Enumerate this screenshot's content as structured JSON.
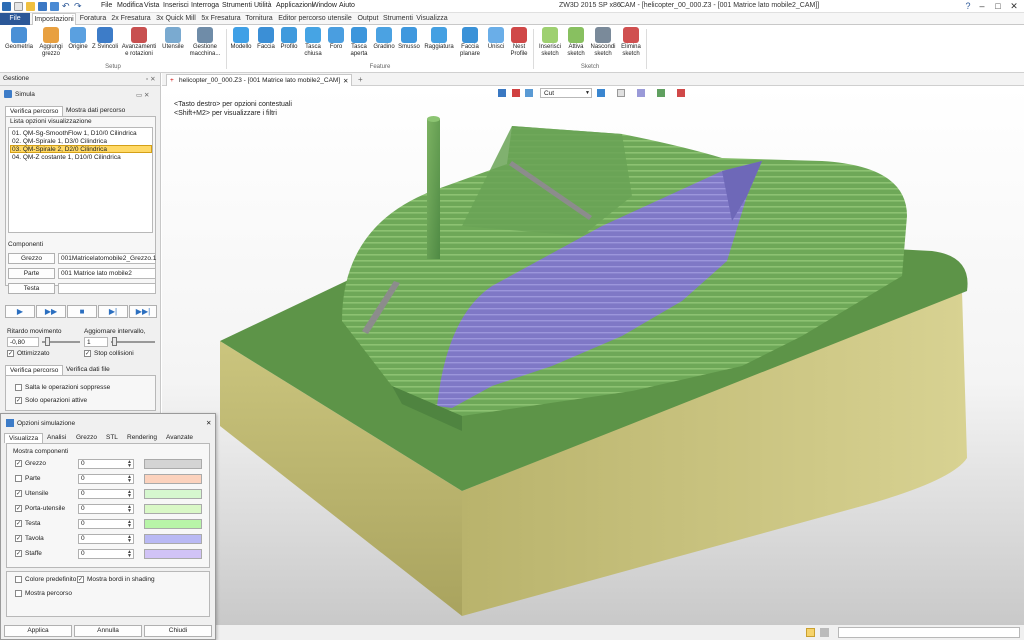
{
  "app": {
    "title": "ZW3D 2015 SP x86",
    "window_title": "CAM - [helicopter_00_000.Z3 - [001 Matrice lato mobile2_CAM]]",
    "menu": [
      "File",
      "Modifica",
      "Vista",
      "Inserisci",
      "Interroga",
      "Strumenti",
      "Utilità",
      "Applicazioni",
      "Window",
      "Aiuto"
    ]
  },
  "ribbon_tabs": [
    "File",
    "Impostazioni",
    "Foratura",
    "2x Fresatura",
    "3x Quick Mill",
    "5x Fresatura",
    "Tornitura",
    "Editor percorso utensile",
    "Output",
    "Strumenti",
    "Visualizza"
  ],
  "ribbon": {
    "setup": [
      "Geometria",
      "Aggiungi\ngrezzo",
      "Origine",
      "Z Svincoli",
      "Avanzamenti\ne rotazioni",
      "Utensile",
      "Gestione\nmacchina..."
    ],
    "feature": [
      "Modello",
      "Faccia",
      "Profilo",
      "Tasca\nchiusa",
      "Foro",
      "Tasca\naperta",
      "Gradino",
      "Smusso",
      "Raggiatura",
      "Faccia\nplanare",
      "Unisci",
      "Nest\nProfile"
    ],
    "sketch": [
      "Inserisci\nsketch",
      "Attiva\nsketch",
      "Nascondi\nsketch",
      "Elimina\nsketch"
    ],
    "groups": [
      "Setup",
      "Feature",
      "Sketch"
    ]
  },
  "panel": {
    "title": "Gestione",
    "simula": "Simula",
    "tabs": [
      "Verifica percorso",
      "Mostra dati percorso"
    ],
    "list_label": "Lista opzioni visualizzazione",
    "operations": [
      "01. QM-Sg-SmoothFlow 1, D10/0 Cilindrica",
      "02. QM-Spirale 1, D3/0 Cilindrica",
      "03. QM-Spirale 2, D2/0 Cilindrica",
      "04. QM-Z costante 1, D10/0 Cilindrica"
    ],
    "componenti_label": "Componenti",
    "grezzo_btn": "Grezzo",
    "grezzo_val": "001Matricelatomobile2_Grezzo.1",
    "parte_btn": "Parte",
    "parte_val": "001 Matrice lato mobile2",
    "testa_btn": "Testa",
    "ritardo_label": "Ritardo movimento",
    "ritardo_val": "-0,80",
    "aggiornare_label": "Aggiornare intervallo,",
    "aggiornare_val": "1",
    "ottimizzato": "Ottimizzato",
    "stop_collisioni": "Stop collisioni",
    "tabs2": [
      "Verifica percorso",
      "Verifica dati file"
    ],
    "salta": "Salta le operazioni soppresse",
    "solo": "Solo operazioni attive"
  },
  "dialog": {
    "title": "Opzioni simulazione",
    "tabs": [
      "Visualizza",
      "Analisi",
      "Grezzo",
      "STL",
      "Rendering",
      "Avanzate"
    ],
    "group_label": "Mostra componenti",
    "rows": [
      {
        "label": "Grezzo",
        "checked": "✓",
        "value": "0",
        "color": "#d4d4d4"
      },
      {
        "label": "Parte",
        "checked": "",
        "value": "0",
        "color": "#fcd2bd"
      },
      {
        "label": "Utensile",
        "checked": "✓",
        "value": "0",
        "color": "#d6f7cf"
      },
      {
        "label": "Porta-utensile",
        "checked": "✓",
        "value": "0",
        "color": "#d9f8c6"
      },
      {
        "label": "Testa",
        "checked": "✓",
        "value": "0",
        "color": "#b8f4a8"
      },
      {
        "label": "Tavola",
        "checked": "✓",
        "value": "0",
        "color": "#b9b9f4"
      },
      {
        "label": "Staffe",
        "checked": "✓",
        "value": "0",
        "color": "#d1c3f6"
      }
    ],
    "colore_predefinito": "Colore predefinito",
    "mostra_bordi": "Mostra bordi in shading",
    "mostra_percorso": "Mostra percorso",
    "applica": "Applica",
    "annulla": "Annulla",
    "chiudi": "Chiudi"
  },
  "viewport": {
    "doc_tab": "helicopter_00_000.Z3 - [001 Matrice lato mobile2_CAM]",
    "hint1": "<Tasto destro> per opzioni contestuali",
    "hint2": "<Shift+M2> per visualizzare i filtri",
    "filter": "Cut"
  },
  "colors": {
    "accent": "#2b5797",
    "selected_row": "#ffd966",
    "model_green": "#6a9f56",
    "model_base": "#c8c27a",
    "toolpath": "#7f78c6"
  }
}
